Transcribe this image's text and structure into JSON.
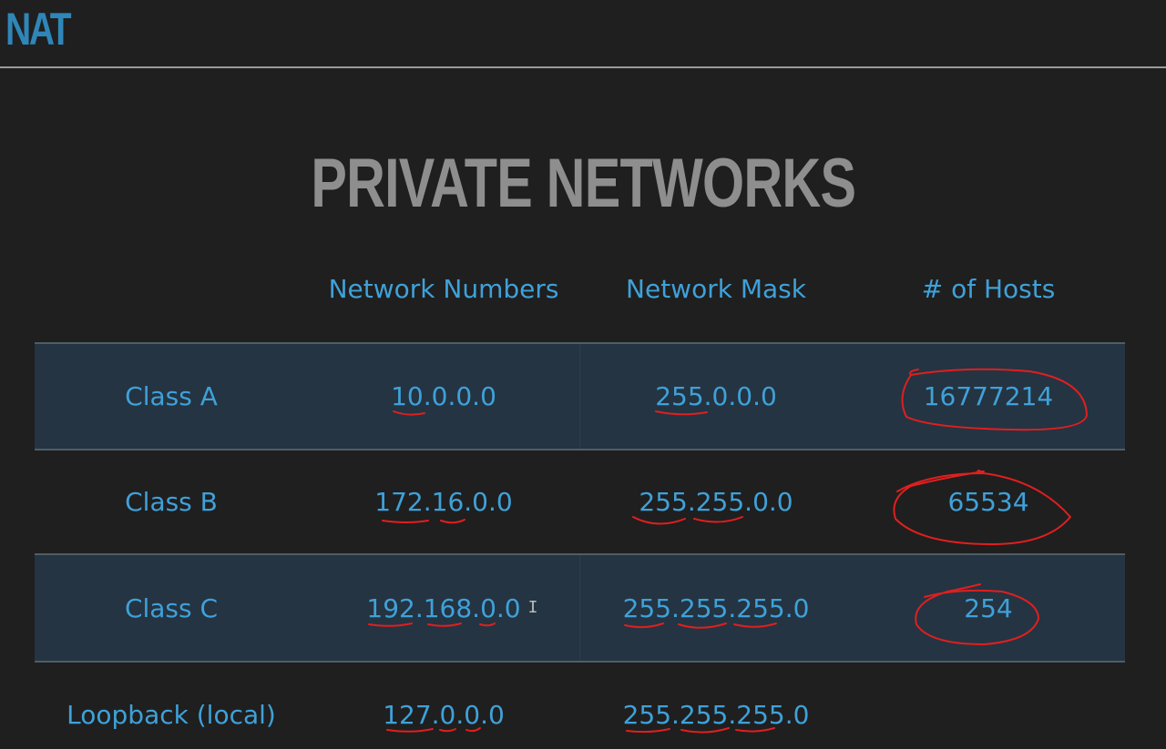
{
  "slide": {
    "title": "NAT",
    "heading": "PRIVATE NETWORKS"
  },
  "table": {
    "columns": [
      "",
      "Network Numbers",
      "Network Mask",
      "# of Hosts"
    ],
    "rows": [
      {
        "label": "Class A",
        "network": "10.0.0.0",
        "mask": "255.0.0.0",
        "hosts": "16777214"
      },
      {
        "label": "Class B",
        "network": "172.16.0.0",
        "mask": "255.255.0.0",
        "hosts": "65534"
      },
      {
        "label": "Class C",
        "network": "192.168.0.0",
        "mask": "255.255.255.0",
        "hosts": "254"
      },
      {
        "label": "Loopback (local)",
        "network": "127.0.0.0",
        "mask": "255.255.255.0",
        "hosts": ""
      }
    ]
  },
  "colors": {
    "background": "#1f1f1f",
    "text_accent": "#3fa1d9",
    "heading": "#8e8e8e",
    "shaded_row": "#243442",
    "annotation_ink": "#e01f1f"
  },
  "icons": {
    "cursor": "text-cursor-icon"
  }
}
